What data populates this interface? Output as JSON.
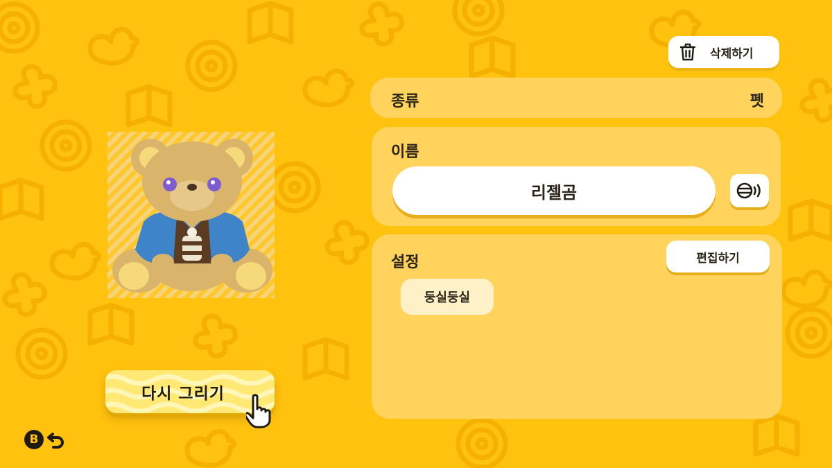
{
  "actions": {
    "delete_label": "삭제하기",
    "redraw_label": "다시 그리기",
    "back_badge": "B"
  },
  "type_row": {
    "label": "종류",
    "value": "펫"
  },
  "name_section": {
    "heading": "이름",
    "value": "리젤곰"
  },
  "settings_section": {
    "heading": "설정",
    "edit_label": "편집하기",
    "tags": [
      "둥실둥실"
    ]
  },
  "icons": {
    "delete": "trash-icon",
    "voice": "speak-icon",
    "back": "undo-arrow-icon",
    "cursor": "pointing-hand-icon"
  },
  "colors": {
    "background": "#FFC20E",
    "panel": "#FFD35C",
    "button": "#FFFFFF",
    "redraw_button": "#FFE873",
    "text": "#2b2418"
  }
}
